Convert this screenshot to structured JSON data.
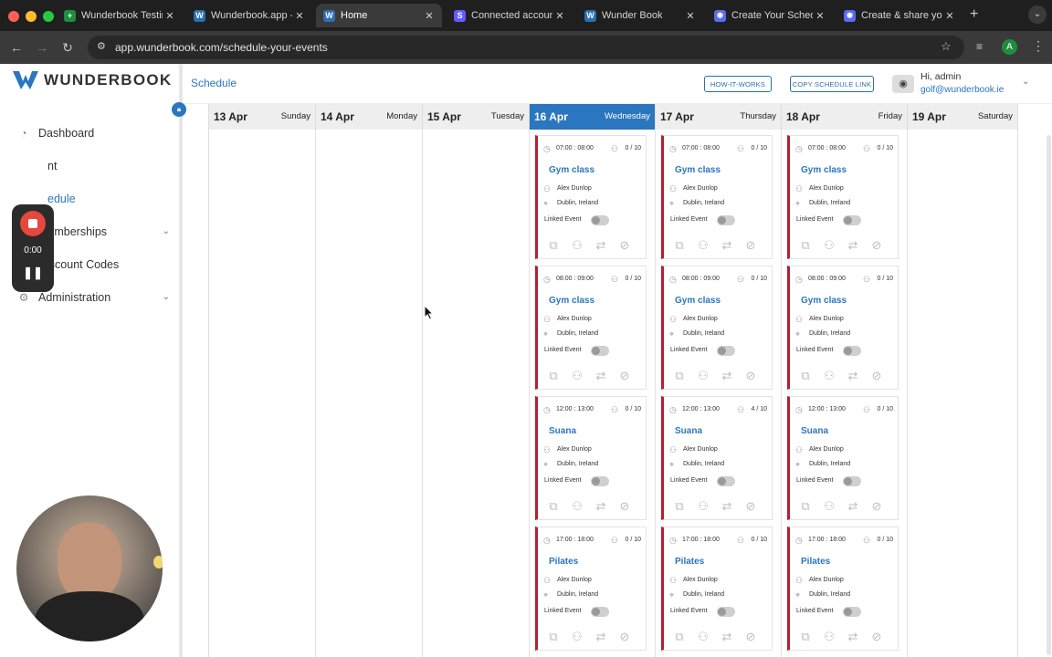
{
  "browser": {
    "tabs": [
      {
        "title": "Wunderbook Testing",
        "favicon": "sheets-icon",
        "color": "#1e8e3e"
      },
      {
        "title": "Wunderbook.app - ",
        "favicon": "wunderbook-icon",
        "color": "#2a6fb0"
      },
      {
        "title": "Home",
        "favicon": "wunderbook-icon",
        "color": "#2a6fb0",
        "active": true
      },
      {
        "title": "Connected accounts",
        "favicon": "stripe-icon",
        "color": "#635bff"
      },
      {
        "title": "Wunder Book",
        "favicon": "wunderbook-icon",
        "color": "#2a6fb0"
      },
      {
        "title": "Create Your Schedule",
        "favicon": "gear-icon",
        "color": "#5b6bf0"
      },
      {
        "title": "Create & share your",
        "favicon": "gear-icon",
        "color": "#5b6bf0"
      }
    ],
    "new_tab_label": "+",
    "url": "app.wunderbook.com/schedule-your-events",
    "profile_initial": "A"
  },
  "app": {
    "logo_text": "WUNDERBOOK",
    "page_title": "Schedule",
    "how_it_works_label": "HOW-IT-WORKS",
    "copy_link_label": "COPY SCHEDULE LINK",
    "greeting": "Hi, admin",
    "user_email": "golf@wunderbook.ie",
    "sidebar": [
      {
        "label": "Dashboard",
        "icon": "dashboard-icon"
      },
      {
        "label": "nt",
        "icon": "event-icon"
      },
      {
        "label": "edule",
        "icon": "schedule-icon",
        "active": true
      },
      {
        "label": "Memberships",
        "icon": "membership-icon",
        "expandable": true
      },
      {
        "label": "Discount Codes",
        "icon": "discount-icon"
      },
      {
        "label": "Administration",
        "icon": "admin-icon",
        "expandable": true
      }
    ]
  },
  "recorder": {
    "timer": "0:00"
  },
  "calendar": {
    "days": [
      {
        "date": "13 Apr",
        "name": "Sunday"
      },
      {
        "date": "14 Apr",
        "name": "Monday"
      },
      {
        "date": "15 Apr",
        "name": "Tuesday"
      },
      {
        "date": "16 Apr",
        "name": "Wednesday",
        "today": true
      },
      {
        "date": "17 Apr",
        "name": "Thursday"
      },
      {
        "date": "18 Apr",
        "name": "Friday"
      },
      {
        "date": "19 Apr",
        "name": "Saturday"
      }
    ],
    "linked_label": "Linked Event",
    "events": [
      {
        "col": 3,
        "row": 0,
        "time": "07:00 : 08:00",
        "cap": "0 / 10",
        "title": "Gym class",
        "instructor": "Alex Dunlop",
        "location": "Dublin, Ireland"
      },
      {
        "col": 3,
        "row": 1,
        "time": "08:00 : 09:00",
        "cap": "0 / 10",
        "title": "Gym class",
        "instructor": "Alex Dunlop",
        "location": "Dublin, Ireland"
      },
      {
        "col": 3,
        "row": 2,
        "time": "12:00 : 13:00",
        "cap": "0 / 10",
        "title": "Suana",
        "instructor": "Alex Dunlop",
        "location": "Dublin, Ireland"
      },
      {
        "col": 3,
        "row": 3,
        "time": "17:00 : 18:00",
        "cap": "0 / 10",
        "title": "Pilates",
        "instructor": "Alex Dunlop",
        "location": "Dublin, Ireland"
      },
      {
        "col": 4,
        "row": 0,
        "time": "07:00 : 08:00",
        "cap": "0 / 10",
        "title": "Gym class",
        "instructor": "Alex Dunlop",
        "location": "Dublin, Ireland"
      },
      {
        "col": 4,
        "row": 1,
        "time": "08:00 : 09:00",
        "cap": "0 / 10",
        "title": "Gym class",
        "instructor": "Alex Dunlop",
        "location": "Dublin, Ireland"
      },
      {
        "col": 4,
        "row": 2,
        "time": "12:00 : 13:00",
        "cap": "4 / 10",
        "title": "Suana",
        "instructor": "Alex Dunlop",
        "location": "Dublin, Ireland"
      },
      {
        "col": 4,
        "row": 3,
        "time": "17:00 : 18:00",
        "cap": "0 / 10",
        "title": "Pilates",
        "instructor": "Alex Dunlop",
        "location": "Dublin, Ireland"
      },
      {
        "col": 5,
        "row": 0,
        "time": "07:00 : 08:00",
        "cap": "0 / 10",
        "title": "Gym class",
        "instructor": "Alex Dunlop",
        "location": "Dublin, Ireland"
      },
      {
        "col": 5,
        "row": 1,
        "time": "08:00 : 09:00",
        "cap": "0 / 10",
        "title": "Gym class",
        "instructor": "Alex Dunlop",
        "location": "Dublin, Ireland"
      },
      {
        "col": 5,
        "row": 2,
        "time": "12:00 : 13:00",
        "cap": "0 / 10",
        "title": "Suana",
        "instructor": "Alex Dunlop",
        "location": "Dublin, Ireland"
      },
      {
        "col": 5,
        "row": 3,
        "time": "17:00 : 18:00",
        "cap": "0 / 10",
        "title": "Pilates",
        "instructor": "Alex Dunlop",
        "location": "Dublin, Ireland"
      }
    ]
  },
  "colors": {
    "accent": "#2a76bf",
    "event_border": "#b3202f",
    "record": "#e5483c"
  }
}
